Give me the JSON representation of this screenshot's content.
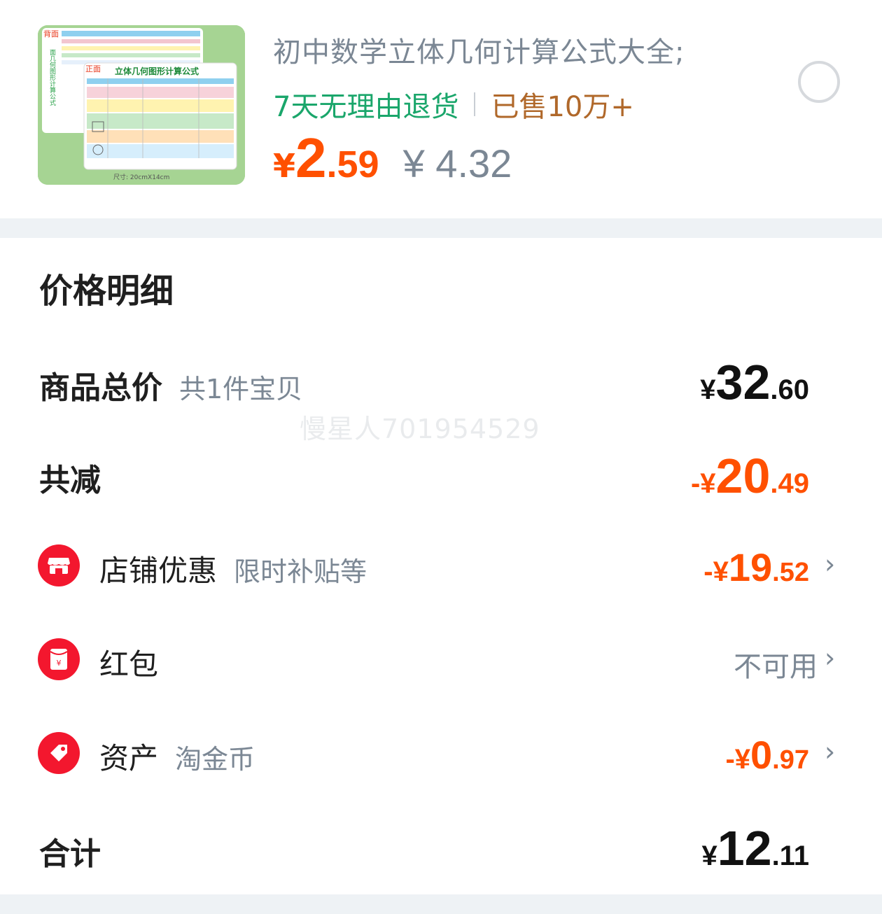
{
  "product": {
    "title": "初中数学立体几何计算公式大全;",
    "tag_return": "7天无理由退货",
    "tag_sold": "已售10万+",
    "price_currency": "¥",
    "price_int": "2",
    "price_dec": ".59",
    "original_price": "¥ 4.32",
    "image_texts": {
      "back_label": "背面",
      "front_label": "正面",
      "card_title": "立体几何图形计算公式",
      "size_text": "尺寸: 20cmX14cm"
    }
  },
  "breakdown": {
    "title": "价格明细",
    "total": {
      "label": "商品总价",
      "sub": "共1件宝贝",
      "cur": "¥",
      "int": "32",
      "dec": ".60"
    },
    "reduction": {
      "label": "共减",
      "cur": "-¥",
      "int": "20",
      "dec": ".49"
    },
    "shop_discount": {
      "label": "店铺优惠",
      "sub": "限时补贴等",
      "cur": "-¥",
      "int": "19",
      "dec": ".52",
      "icon": "store-icon"
    },
    "red_packet": {
      "label": "红包",
      "value": "不可用",
      "icon": "red-envelope-icon"
    },
    "assets": {
      "label": "资产",
      "sub": "淘金币",
      "cur": "-¥",
      "int": "0",
      "dec": ".97",
      "icon": "tag-icon"
    },
    "sum": {
      "label": "合计",
      "cur": "¥",
      "int": "12",
      "dec": ".11"
    },
    "chevron": "›"
  },
  "watermark": "慢星人701954529",
  "colors": {
    "accent": "#ff5000",
    "green": "#1aa66b",
    "brown": "#b0682a",
    "icon_red": "#f3172e",
    "gray": "#7b8794"
  }
}
